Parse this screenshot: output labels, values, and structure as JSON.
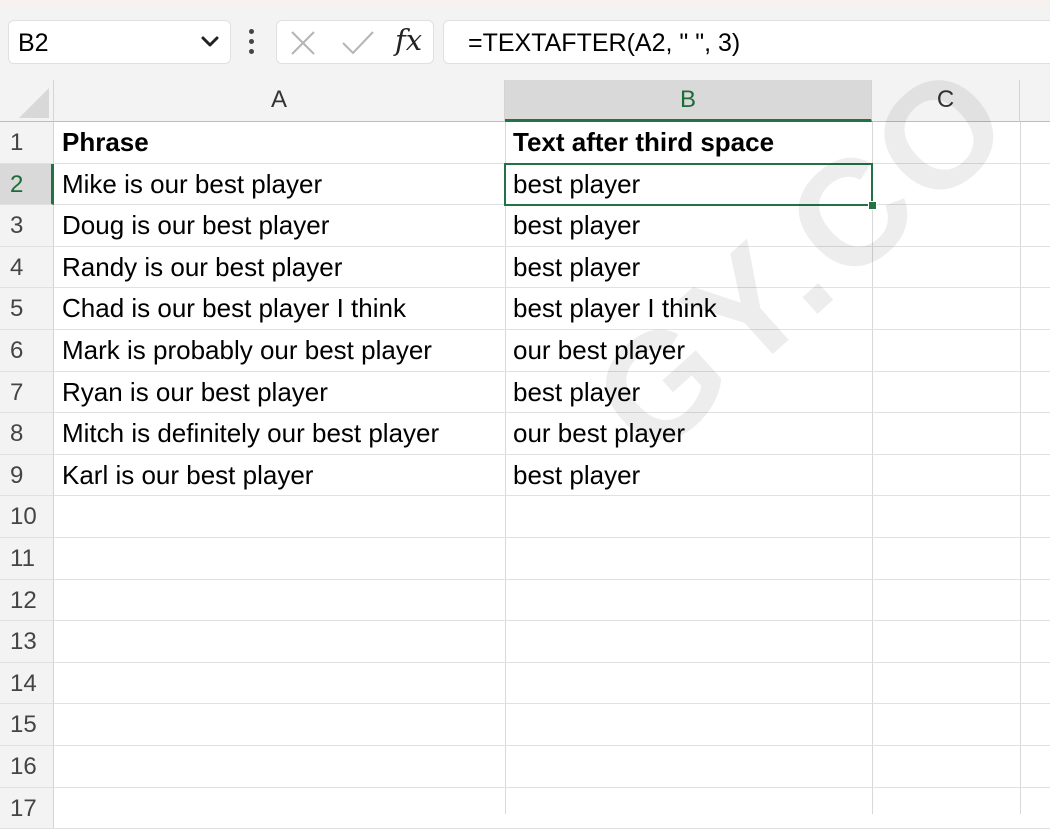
{
  "name_box": {
    "value": "B2"
  },
  "formula_bar": {
    "formula": "=TEXTAFTER(A2, \" \", 3)",
    "function_label": "fx"
  },
  "columns": [
    "A",
    "B",
    "C"
  ],
  "selected_column": "B",
  "row_numbers": [
    "1",
    "2",
    "3",
    "4",
    "5",
    "6",
    "7",
    "8",
    "9",
    "10",
    "11",
    "12",
    "13",
    "14",
    "15",
    "16",
    "17"
  ],
  "selected_row": "2",
  "cells": {
    "A": [
      "Phrase",
      "Mike is our best player",
      "Doug is our best player",
      "Randy is our best player",
      "Chad is our best player I think",
      "Mark is probably our best player",
      "Ryan is our best player",
      "Mitch is definitely our best player",
      "Karl is our best player"
    ],
    "B": [
      "Text after third space",
      "best player",
      "best player",
      "best player",
      "best player I think",
      "our best player",
      "best player",
      "our best player",
      "best player"
    ]
  },
  "header_row_bold": true,
  "active_cell": "B2",
  "colors": {
    "accent": "#217346",
    "header_bg": "#f3f3f3",
    "selected_header_bg": "#d9d9d9"
  },
  "watermark": "GY.CO"
}
